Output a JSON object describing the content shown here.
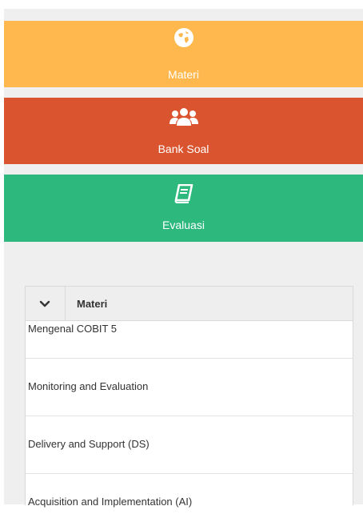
{
  "nav": {
    "materi": {
      "label": "Materi",
      "icon": "globe-icon",
      "color": "#ffb84d"
    },
    "bank_soal": {
      "label": "Bank Soal",
      "icon": "users-icon",
      "color": "#d9542f"
    },
    "evaluasi": {
      "label": "Evaluasi",
      "icon": "book-icon",
      "color": "#2db87e"
    }
  },
  "table": {
    "header": {
      "icon": "chevron-down-icon",
      "title": "Materi"
    },
    "rows": [
      "Mengenal COBIT 5",
      "Monitoring and Evaluation",
      "Delivery and Support (DS)",
      "Acquisition and Implementation (AI)"
    ]
  }
}
